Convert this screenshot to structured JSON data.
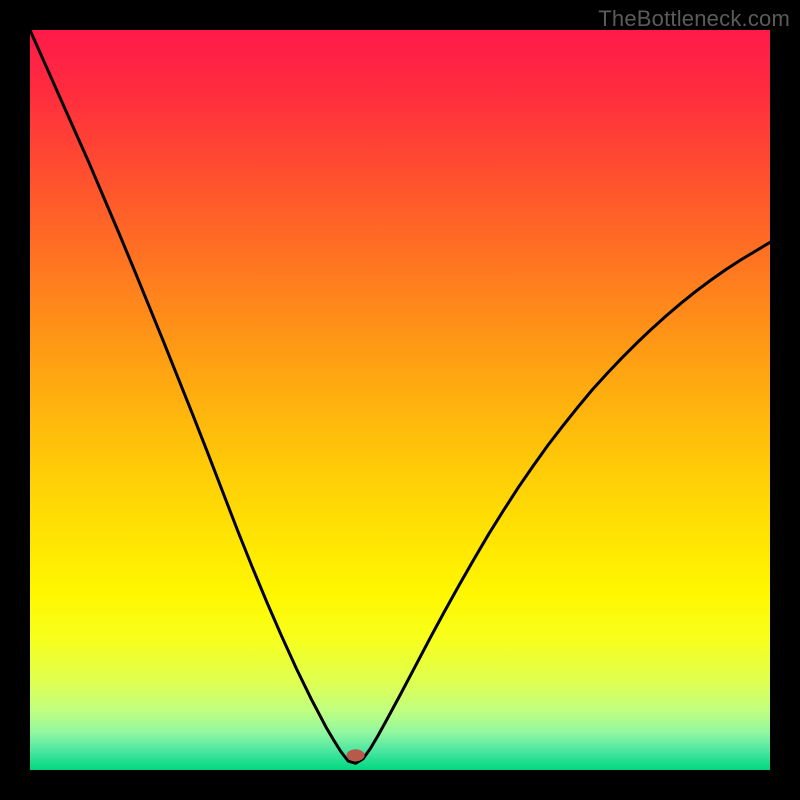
{
  "watermark": "TheBottleneck.com",
  "chart_data": {
    "type": "line",
    "title": "",
    "xlabel": "",
    "ylabel": "",
    "xlim": [
      0,
      100
    ],
    "ylim": [
      0,
      100
    ],
    "grid": false,
    "legend": false,
    "marker": {
      "x": 44,
      "y": 2,
      "color": "#b85a4a"
    },
    "series": [
      {
        "name": "curve",
        "color": "#000000",
        "x": [
          0,
          2,
          4,
          6,
          8,
          10,
          12,
          14,
          16,
          18,
          20,
          22,
          24,
          26,
          28,
          30,
          32,
          34,
          36,
          38,
          40,
          41,
          42,
          43,
          44,
          45,
          46,
          47,
          48,
          50,
          52,
          54,
          56,
          58,
          60,
          62,
          64,
          66,
          68,
          70,
          72,
          74,
          76,
          78,
          80,
          82,
          84,
          86,
          88,
          90,
          92,
          94,
          96,
          98,
          100
        ],
        "y": [
          100,
          95.5,
          91,
          86.5,
          82,
          77.3,
          72.6,
          67.8,
          62.9,
          58,
          53,
          48,
          42.9,
          37.7,
          32.5,
          27.5,
          22.7,
          18.1,
          13.7,
          9.6,
          5.8,
          4.1,
          2.5,
          1.2,
          0.9,
          1.5,
          2.9,
          4.6,
          6.4,
          10.1,
          13.9,
          17.7,
          21.4,
          25,
          28.5,
          31.9,
          35.1,
          38.2,
          41.1,
          43.9,
          46.5,
          49,
          51.4,
          53.6,
          55.7,
          57.7,
          59.6,
          61.4,
          63.1,
          64.7,
          66.2,
          67.6,
          68.9,
          70.1,
          71.3
        ]
      }
    ],
    "background_gradient": {
      "type": "vertical",
      "stops": [
        {
          "pos": 0.0,
          "color": "#ff1a49"
        },
        {
          "pos": 0.08,
          "color": "#ff2b3f"
        },
        {
          "pos": 0.18,
          "color": "#ff4a31"
        },
        {
          "pos": 0.28,
          "color": "#ff6a25"
        },
        {
          "pos": 0.38,
          "color": "#ff8a1a"
        },
        {
          "pos": 0.48,
          "color": "#ffaa10"
        },
        {
          "pos": 0.58,
          "color": "#ffc808"
        },
        {
          "pos": 0.68,
          "color": "#ffe303"
        },
        {
          "pos": 0.76,
          "color": "#fff700"
        },
        {
          "pos": 0.82,
          "color": "#f8ff1a"
        },
        {
          "pos": 0.88,
          "color": "#e0ff50"
        },
        {
          "pos": 0.92,
          "color": "#c0ff80"
        },
        {
          "pos": 0.95,
          "color": "#90f7a0"
        },
        {
          "pos": 0.975,
          "color": "#48e6a0"
        },
        {
          "pos": 1.0,
          "color": "#00d880"
        }
      ]
    }
  }
}
